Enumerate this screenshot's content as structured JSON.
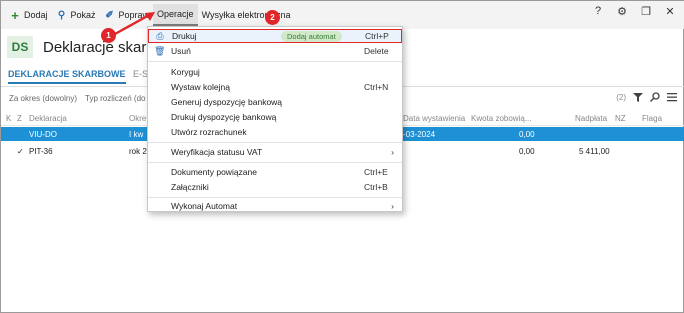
{
  "toolbar": {
    "add_label": "Dodaj",
    "show_label": "Pokaż",
    "fix_label": "Popraw",
    "operations_label": "Operacje",
    "esend_label": "Wysyłka elektroniczna",
    "help": "?",
    "settings": "⚙",
    "restore": "❐",
    "close": "✕"
  },
  "header": {
    "logo": "DS",
    "title": "Deklaracje skarbowe"
  },
  "tabs": {
    "active": "DEKLARACJE SKARBOWE",
    "other": "E-S"
  },
  "filters": {
    "period": "Za okres (dowolny)",
    "type": "Typ rozliczeń (do",
    "count": "(2)"
  },
  "grid": {
    "headers": {
      "k": "K",
      "z": "Z",
      "declaration": "Deklaracja",
      "period": "Okre",
      "issue_date": "Data wystawienia",
      "amount_due": "Kwota zobowią...",
      "overpaid": "Nadpłata",
      "nz": "NZ",
      "flag": "Flaga"
    },
    "rows": [
      {
        "declaration": "VIU-DO",
        "period": "I kw",
        "issue_date": "-03-2024",
        "amount_due": "0,00",
        "overpaid": "",
        "check": ""
      },
      {
        "declaration": "PIT-36",
        "period": "rok 2",
        "issue_date": "",
        "amount_due": "0,00",
        "overpaid": "5 411,00",
        "check": "✓"
      }
    ]
  },
  "menu": {
    "print": {
      "label": "Drukuj",
      "badge": "Dodaj automat",
      "key": "Ctrl+P"
    },
    "delete": {
      "label": "Usuń",
      "key": "Delete"
    },
    "correct": {
      "label": "Koryguj"
    },
    "next": {
      "label": "Wystaw kolejną",
      "key": "Ctrl+N"
    },
    "gen_bank": {
      "label": "Generuj dyspozycję bankową"
    },
    "print_bank": {
      "label": "Drukuj dyspozycję bankową"
    },
    "create_settlement": {
      "label": "Utwórz rozrachunek"
    },
    "vat_verify": {
      "label": "Weryfikacja statusu VAT"
    },
    "related_docs": {
      "label": "Dokumenty powiązane",
      "key": "Ctrl+E"
    },
    "attachments": {
      "label": "Załączniki",
      "key": "Ctrl+B"
    },
    "run_automat": {
      "label": "Wykonaj Automat"
    }
  },
  "callouts": {
    "one": "1",
    "two": "2"
  },
  "colors": {
    "accent": "#2a7ab5",
    "selection": "#1e90d6",
    "highlight": "#e0262b",
    "badge_bg": "#cfe9c9"
  }
}
